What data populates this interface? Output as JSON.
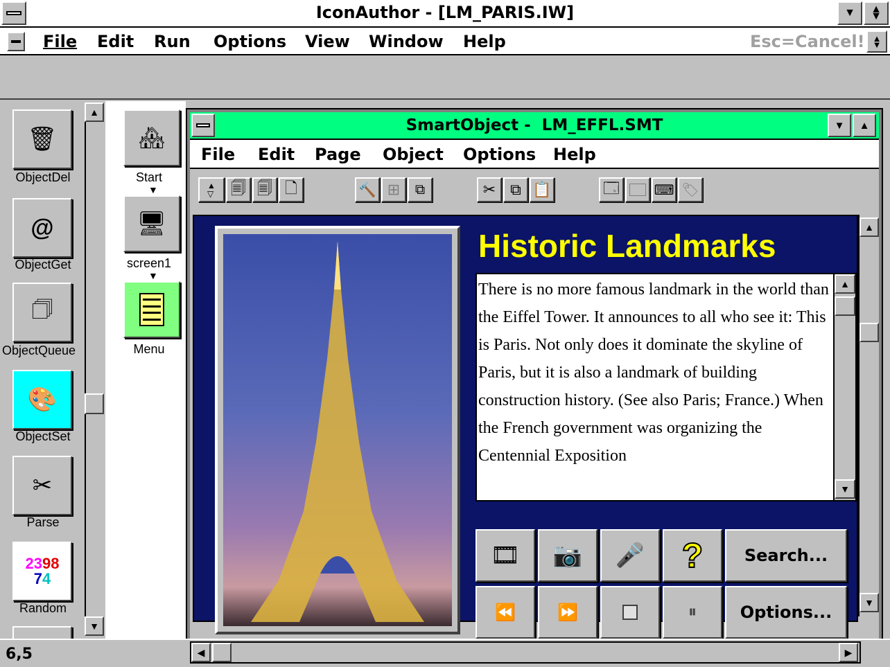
{
  "app": {
    "title": "IconAuthor - [LM_PARIS.IW]",
    "menus": [
      "File",
      "Edit",
      "Run",
      "Options",
      "View",
      "Window",
      "Help"
    ],
    "cancel_hint": "Esc=Cancel!",
    "status_coords": "6,5"
  },
  "palette": {
    "items": [
      {
        "label": "ObjectDel",
        "icon": "object-delete-icon"
      },
      {
        "label": "ObjectGet",
        "icon": "object-get-icon"
      },
      {
        "label": "ObjectQueue",
        "icon": "object-queue-icon"
      },
      {
        "label": "ObjectSet",
        "icon": "object-set-icon"
      },
      {
        "label": "Parse",
        "icon": "parse-icon"
      },
      {
        "label": "Random",
        "icon": "random-icon"
      }
    ]
  },
  "flow": {
    "items": [
      {
        "label": "Start",
        "icon": "start-house-icon"
      },
      {
        "label": "screen1",
        "icon": "screen-computer-icon"
      },
      {
        "label": "Menu",
        "icon": "menu-list-icon"
      }
    ]
  },
  "smartobject": {
    "title": "SmartObject -  LM_EFFL.SMT",
    "menus": [
      "File",
      "Edit",
      "Page",
      "Object",
      "Options",
      "Help"
    ],
    "content": {
      "heading": "Historic Landmarks",
      "body": "There is no more famous landmark in the world than the Eiffel Tower. It announces to all who see it: This is Paris. Not only does it dominate the skyline of Paris, but it is also a landmark of building construction history. (See also Paris; France.)   When the French government was organizing the Centennial Exposition",
      "search_label": "Search...",
      "options_label": "Options..."
    }
  },
  "colors": {
    "title_active": "#00ff80",
    "content_bg": "#0b1466",
    "heading": "#ffff00",
    "toolbar_active": "#00ffff"
  }
}
